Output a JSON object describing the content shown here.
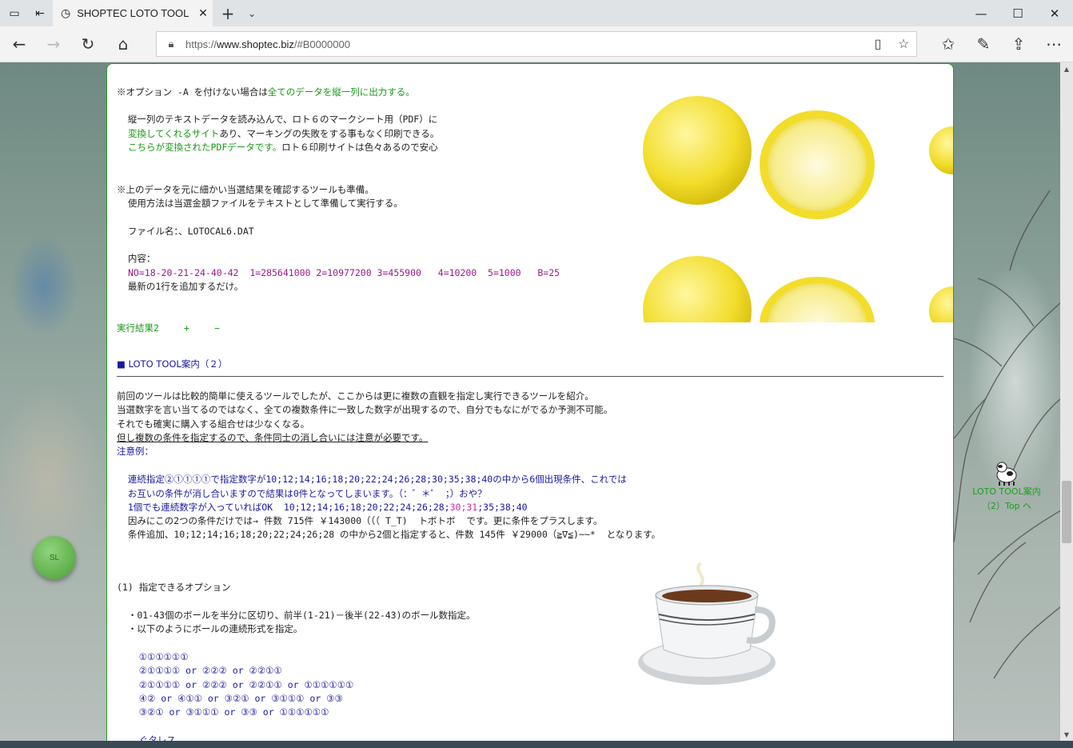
{
  "browser": {
    "tab_title": "SHOPTEC LOTO TOOL",
    "url_prefix": "https://",
    "url_host": "www.shoptec.biz",
    "url_rest": "/#B0000000"
  },
  "content": {
    "p1_a": "※オプション -A を付けない場合は",
    "p1_b": "全てのデータを縦一列に出力する。",
    "p2_a": "  縦一列のテキストデータを読み込んで、ロト６のマークシート用（PDF）に",
    "p2_b": "変換してくれるサイト",
    "p2_c": "あり、マーキングの失敗をする事もなく印刷できる。",
    "p2_d": "こちらが変換されたPDFデータです。",
    "p2_e": "ロト６印刷サイトは色々あるので安心",
    "p3_a": "※上のデータを元に細かい当選結果を確認するツールも準備。",
    "p3_b": "  使用方法は当選金額ファイルをテキストとして準備して実行する。",
    "p3_c": "  ファイル名：、LOTOCAL6.DAT",
    "p3_d": "  内容：",
    "p3_e": "NO=18-20-21-24-40-42  1=285641000 2=10977200 3=455900   4=10200  5=1000   B=25",
    "p3_f": "  最新の1行を追加するだけ。",
    "result_label": "実行結果2",
    "plus": "+",
    "minus": "−",
    "section_title": "■ LOTO TOOL案内（２）",
    "q1": "前回のツールは比較的簡単に使えるツールでしたが、ここからは更に複数の直観を指定し実行できるツールを紹介。",
    "q2": "当選数字を言い当てるのではなく、全ての複数条件に一致した数字が出現するので、自分でもなにがでるか予測不可能。",
    "q3": "それでも確実に購入する組合せは少なくなる。",
    "q4": "但し複数の条件を指定するので、条件同士の消し合いには注意が必要です。",
    "q5": "注意例：",
    "e1": "  連続指定②①①①①で指定数字が10;12;14;16;18;20;22;24;26;28;30;35;38;40の中から6個出現条件、これでは",
    "e2": "  お互いの条件が消し合いますので結果は0件となってしまいます。（：゛＊゜ ；）おや？",
    "e3_a": "  1個でも連続数字が入っていればOK  10;12;14;16;18;20;22;24;26;28;",
    "e3_b": "30;31",
    "e3_c": ";35;38;40",
    "e4": "  因みにこの2つの条件だけでは→ 件数 715件 ￥143000（（（ T_T)  トボトボ  です。更に条件をプラスします。",
    "e5": "  条件追加、10;12;14;16;18;20;22;24;26;28 の中から2個と指定すると、件数 145件 ￥29000（≧∇≦)~~*  となります。",
    "o1": "(1) 指定できるオプション",
    "o2": "  ・01-43個のボールを半分に区切り、前半(1-21)－後半(22-43)のボール数指定。",
    "o3": "  ・以下のようにボールの連続形式を指定。",
    "c1": "    ①①①①①①",
    "c2": "    ②①①①① or ②②② or ②②①①",
    "c3": "    ②①①①① or ②②② or ②②①① or ①①①①①①",
    "c4": "    ④② or ④①① or ③②① or ③①①① or ③③",
    "c5": "    ③②① or ③①①① or ③③ or ①①①①①①",
    "c6": "    ぐタレス"
  },
  "widgets": {
    "sl_button": "SL",
    "top_link_1": "LOTO TOOL案内",
    "top_link_2": "（2）Top へ"
  }
}
